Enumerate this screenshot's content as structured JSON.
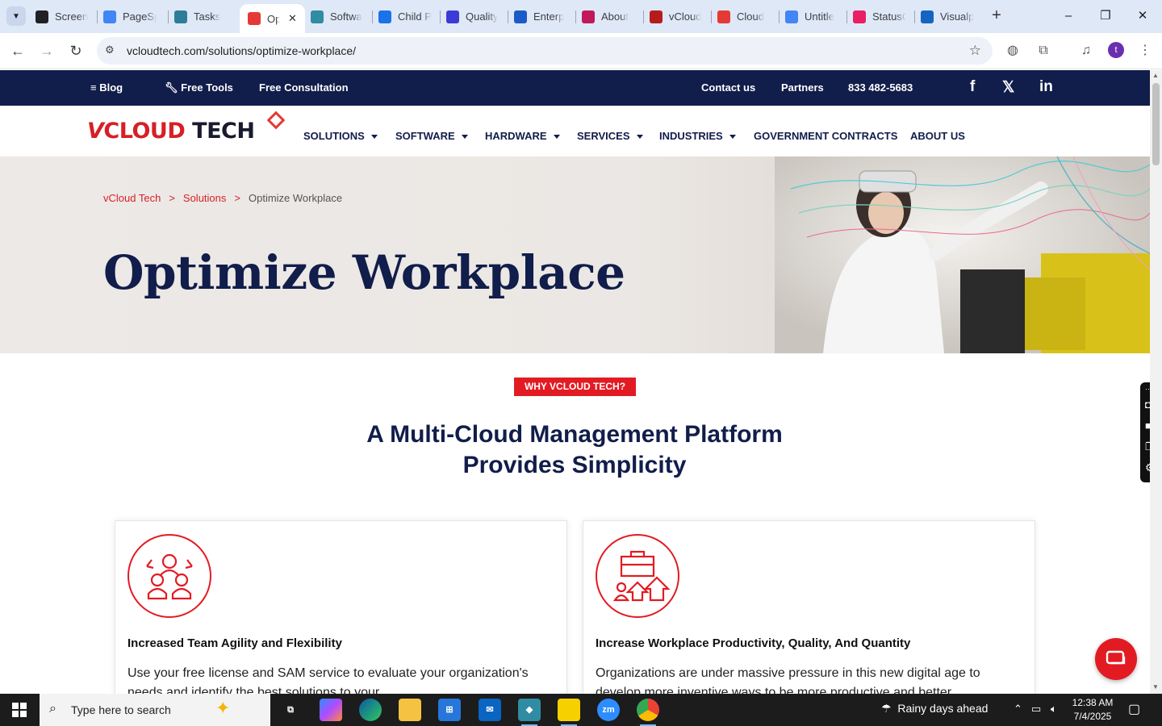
{
  "browser": {
    "tabs": [
      {
        "title": "Screen",
        "favicon_color": "#202124",
        "active": false
      },
      {
        "title": "PageSp",
        "favicon_color": "#4285f4",
        "active": false
      },
      {
        "title": "Tasks",
        "favicon_color": "#2f7c99",
        "active": false
      },
      {
        "title": "Op",
        "favicon_color": "#e53935",
        "active": true
      },
      {
        "title": "Softwa",
        "favicon_color": "#2f8ca3",
        "active": false
      },
      {
        "title": "Child P",
        "favicon_color": "#1a73e8",
        "active": false
      },
      {
        "title": "Quality",
        "favicon_color": "#3b3bd6",
        "active": false
      },
      {
        "title": "Enterp",
        "favicon_color": "#1a5bc8",
        "active": false
      },
      {
        "title": "About",
        "favicon_color": "#c2185b",
        "active": false
      },
      {
        "title": "vCloud",
        "favicon_color": "#b71c1c",
        "active": false
      },
      {
        "title": "Cloud",
        "favicon_color": "#e53935",
        "active": false
      },
      {
        "title": "Untitle",
        "favicon_color": "#4285f4",
        "active": false
      },
      {
        "title": "StatusC",
        "favicon_color": "#e91e63",
        "active": false
      },
      {
        "title": "Visualp",
        "favicon_color": "#1565c0",
        "active": false
      }
    ],
    "url": "vcloudtech.com/solutions/optimize-workplace/",
    "profile_initial": "t"
  },
  "topbar": {
    "blog": "Blog",
    "free_tools": "Free Tools",
    "free_consultation": "Free Consultation",
    "contact": "Contact us",
    "partners": "Partners",
    "phone": "833 482-5683",
    "social": {
      "facebook": "f",
      "x": "𝕏",
      "linkedin": "in"
    }
  },
  "logo": {
    "v": "V",
    "cloud": "CLOUD",
    "tech": "TECH"
  },
  "nav": {
    "solutions": "SOLUTIONS",
    "software": "SOFTWARE",
    "hardware": "HARDWARE",
    "services": "SERVICES",
    "industries": "INDUSTRIES",
    "government": "GOVERNMENT CONTRACTS",
    "about": "ABOUT US"
  },
  "hero": {
    "breadcrumb": {
      "home": "vCloud Tech",
      "sep": ">",
      "solutions": "Solutions",
      "current": "Optimize Workplace"
    },
    "title": "Optimize Workplace"
  },
  "why": {
    "badge": "WHY VCLOUD TECH?",
    "title_line1": "A Multi-Cloud Management Platform",
    "title_line2": "Provides Simplicity"
  },
  "cards": [
    {
      "title": "Increased Team Agility and Flexibility",
      "text": "Use your free license and SAM service to evaluate your organization's needs and identify the best solutions to your"
    },
    {
      "title": "Increase Workplace Productivity, Quality, And Quantity",
      "text": "Organizations are under massive pressure in this new digital age to develop more inventive ways to be more productive and better"
    }
  ],
  "taskbar": {
    "search_placeholder": "Type here to search",
    "weather": "Rainy days ahead",
    "time": "12:38 AM",
    "date": "7/4/2025"
  },
  "colors": {
    "brand_red": "#e21b23",
    "brand_navy": "#111d4a"
  }
}
